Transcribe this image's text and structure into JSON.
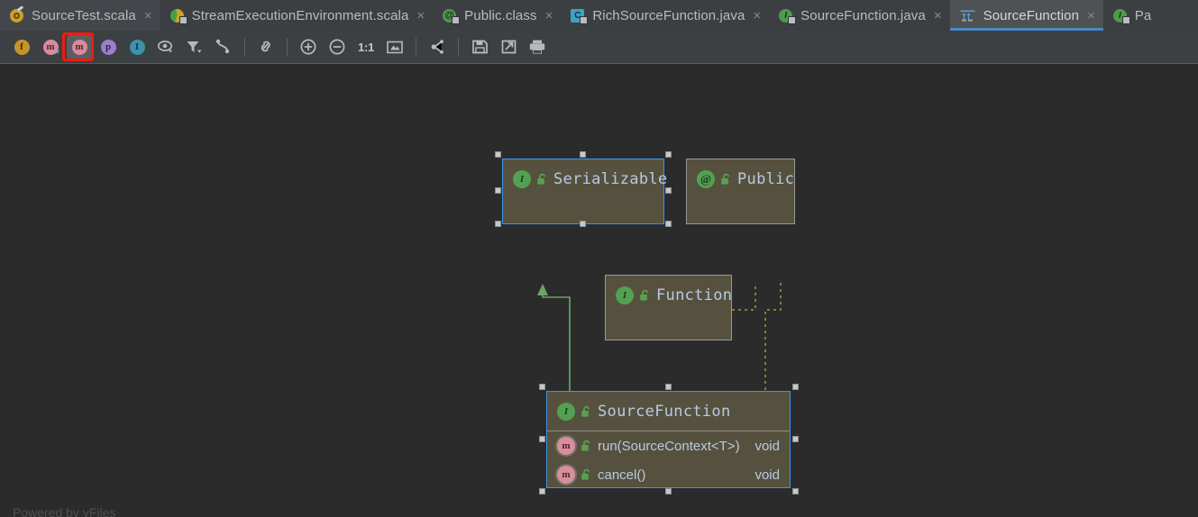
{
  "window": {
    "background_color": "#2b2b2b",
    "toolbar_color": "#3c4043",
    "tabbar_color": "#3c3f41",
    "accent_color": "#4a88c7",
    "highlight_color": "#f01a12"
  },
  "tabs": [
    {
      "label": "SourceTest.scala",
      "icon": "scala-object-icon",
      "close": "×",
      "active": false,
      "style": "alt"
    },
    {
      "label": "StreamExecutionEnvironment.scala",
      "icon": "scala-class-icon",
      "close": "×",
      "active": false,
      "style": "plain"
    },
    {
      "label": "Public.class",
      "icon": "annotation-icon",
      "close": "×",
      "active": false,
      "style": "plain"
    },
    {
      "label": "RichSourceFunction.java",
      "icon": "java-class-icon",
      "close": "×",
      "active": false,
      "style": "plain"
    },
    {
      "label": "SourceFunction.java",
      "icon": "java-interface-icon",
      "close": "×",
      "active": false,
      "style": "plain"
    },
    {
      "label": "SourceFunction",
      "icon": "uml-diagram-icon",
      "close": "×",
      "active": true,
      "style": "plain"
    },
    {
      "label": "Pa",
      "icon": "java-interface-icon",
      "close": "",
      "active": false,
      "style": "plain"
    }
  ],
  "toolbar": {
    "buttons": [
      {
        "name": "show-fields-button",
        "glyph": "f",
        "kind": "disc",
        "color_class": "c-f",
        "pressed": false,
        "badge": ""
      },
      {
        "name": "show-constructors-button",
        "glyph": "m",
        "kind": "disc",
        "color_class": "c-m",
        "pressed": false,
        "badge": "★"
      },
      {
        "name": "show-methods-button",
        "glyph": "m",
        "kind": "disc",
        "color_class": "c-m",
        "pressed": true,
        "badge": ""
      },
      {
        "name": "show-properties-button",
        "glyph": "p",
        "kind": "disc",
        "color_class": "c-p",
        "pressed": false,
        "badge": ""
      },
      {
        "name": "show-inner-classes-button",
        "glyph": "I",
        "kind": "disc",
        "color_class": "c-i",
        "pressed": false,
        "badge": ""
      },
      {
        "name": "visibility-button",
        "glyph": "visibility-eye-icon",
        "kind": "svg",
        "pressed": false,
        "badge": ""
      },
      {
        "name": "filter-button",
        "glyph": "filter-funnel-icon",
        "kind": "svg",
        "pressed": false,
        "badge": ""
      },
      {
        "name": "edges-style-button",
        "glyph": "edge-curve-icon",
        "kind": "svg",
        "pressed": false,
        "badge": ""
      },
      {
        "name": "separator-1",
        "glyph": "",
        "kind": "sep",
        "pressed": false,
        "badge": ""
      },
      {
        "name": "show-dependencies-button",
        "glyph": "link-chain-icon",
        "kind": "svg",
        "pressed": false,
        "badge": ""
      },
      {
        "name": "separator-2",
        "glyph": "",
        "kind": "sep",
        "pressed": false,
        "badge": ""
      },
      {
        "name": "zoom-in-button",
        "glyph": "zoom-in-icon",
        "kind": "svg",
        "pressed": false,
        "badge": ""
      },
      {
        "name": "zoom-out-button",
        "glyph": "zoom-out-icon",
        "kind": "svg",
        "pressed": false,
        "badge": ""
      },
      {
        "name": "actual-size-button",
        "glyph": "1:1",
        "kind": "text",
        "pressed": false,
        "badge": ""
      },
      {
        "name": "fit-content-button",
        "glyph": "fit-screen-icon",
        "kind": "svg",
        "pressed": false,
        "badge": ""
      },
      {
        "name": "separator-3",
        "glyph": "",
        "kind": "sep",
        "pressed": false,
        "badge": ""
      },
      {
        "name": "layout-button",
        "glyph": "graph-layout-icon",
        "kind": "svg",
        "pressed": false,
        "badge": ""
      },
      {
        "name": "separator-4",
        "glyph": "",
        "kind": "sep",
        "pressed": false,
        "badge": ""
      },
      {
        "name": "save-button",
        "glyph": "save-floppy-icon",
        "kind": "svg",
        "pressed": false,
        "badge": ""
      },
      {
        "name": "export-button",
        "glyph": "export-arrow-icon",
        "kind": "svg",
        "pressed": false,
        "badge": ""
      },
      {
        "name": "print-button",
        "glyph": "printer-icon",
        "kind": "svg",
        "pressed": false,
        "badge": ""
      }
    ],
    "actual_size_label": "1:1"
  },
  "diagram": {
    "watermark": "Powered by yFiles",
    "nodes": [
      {
        "id": "serializable",
        "title": "Serializable",
        "icon": "interface-icon",
        "icon_glyph": "I",
        "lock": "unlocked-icon",
        "selected": true,
        "members": []
      },
      {
        "id": "public",
        "title": "Public",
        "icon": "annotation-icon",
        "icon_glyph": "@",
        "lock": "unlocked-icon",
        "selected": false,
        "members": []
      },
      {
        "id": "function",
        "title": "Function",
        "icon": "interface-icon",
        "icon_glyph": "I",
        "lock": "unlocked-icon",
        "selected": false,
        "members": []
      },
      {
        "id": "sourcefunction",
        "title": "SourceFunction",
        "icon": "interface-icon",
        "icon_glyph": "I",
        "lock": "unlocked-icon",
        "selected": true,
        "members": [
          {
            "icon": "method-icon",
            "icon_glyph": "m",
            "lock": "unlocked-icon",
            "name": "run(SourceContext<T>)",
            "type": "void"
          },
          {
            "icon": "method-icon",
            "icon_glyph": "m",
            "lock": "unlocked-icon",
            "name": "cancel()",
            "type": "void"
          }
        ]
      }
    ],
    "edges": [
      {
        "from": "sourcefunction",
        "to": "serializable",
        "style": "solid",
        "color": "#68a862",
        "kind": "extends"
      },
      {
        "from": "function",
        "to": "serializable",
        "style": "solid",
        "color": "#68a862",
        "kind": "extends"
      },
      {
        "from": "sourcefunction",
        "to": "function",
        "style": "solid",
        "color": "#68a862",
        "kind": "extends"
      },
      {
        "from": "function",
        "to": "public",
        "style": "dashed",
        "color": "#a89a2e",
        "kind": "annotated-by"
      },
      {
        "from": "sourcefunction",
        "to": "public",
        "style": "dashed",
        "color": "#a89a2e",
        "kind": "annotated-by"
      }
    ]
  }
}
